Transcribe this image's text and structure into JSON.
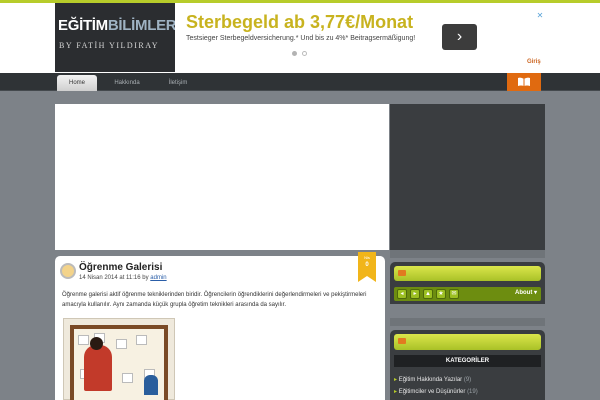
{
  "logo": {
    "word1": "EĞİTİM",
    "word2": "BİLİMLERİ",
    "byline": "BY FATİH YILDIRAY"
  },
  "ad": {
    "title": "Sterbegeld ab 3,77€/Monat",
    "text": "Testsieger Sterbegeldversicherung.* Und bis zu 4%* Beitragsermäßigung!",
    "arrow": "›",
    "close": "✕"
  },
  "header": {
    "login": "Giriş"
  },
  "nav": {
    "items": [
      {
        "label": "Home"
      },
      {
        "label": "Hakkında"
      },
      {
        "label": "İletişim"
      }
    ],
    "book_icon": "open-book-icon"
  },
  "post": {
    "title": "Öğrenme Galerisi",
    "date": "14 Nisan 2014 at 11:16 by",
    "author": "admin",
    "ribbon_month": "Nis",
    "ribbon_day": "0",
    "body": "Öğrenme galerisi aktif öğrenme tekniklerinden biridir. Öğrencilerin öğrendiklerini değerlendirmeleri ve pekiştirmeleri amacıyla kullanılır. Aynı zamanda küçük grupla öğretim teknikleri arasında da sayılır."
  },
  "sidebar": {
    "toolbar_label": "About ▾",
    "categories_title": "KATEGORİLER",
    "categories": [
      {
        "name": "Eğitim Hakkında Yazılar",
        "count": "(9)"
      },
      {
        "name": "Eğitimciler ve Düşünürler",
        "count": "(19)"
      }
    ]
  },
  "colors": {
    "accent_green": "#b7cc2a",
    "accent_orange": "#e06a10",
    "background": "#7d8288"
  }
}
